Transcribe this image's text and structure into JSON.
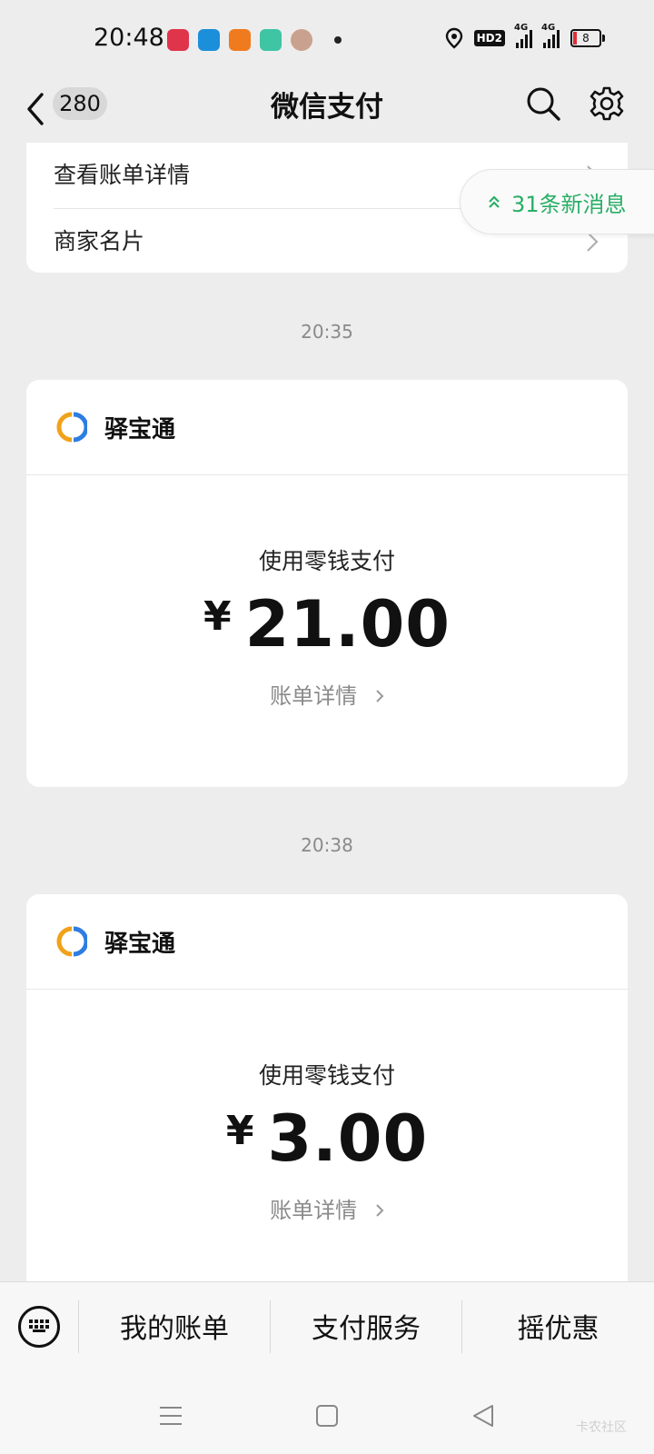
{
  "status_bar": {
    "time": "20:48",
    "hd_label": "HD2",
    "network1": "4G",
    "network2": "4G",
    "battery": "8",
    "app_icon_colors": [
      "#e0344a",
      "#1b8fd9",
      "#f07a1e",
      "#3fc4a4",
      "#caa08e"
    ]
  },
  "nav": {
    "badge_count": "280",
    "title": "微信支付"
  },
  "top_card": {
    "item1": "查看账单详情",
    "item2": "商家名片"
  },
  "new_messages": "31条新消息",
  "messages": [
    {
      "time": "20:35",
      "merchant": "驿宝通",
      "method": "使用零钱支付",
      "currency": "¥",
      "amount": "21.00",
      "detail": "账单详情"
    },
    {
      "time": "20:38",
      "merchant": "驿宝通",
      "method": "使用零钱支付",
      "currency": "¥",
      "amount": "3.00",
      "detail": "账单详情"
    }
  ],
  "bottom_menu": {
    "item1": "我的账单",
    "item2": "支付服务",
    "item3": "摇优惠"
  },
  "watermark": "卡农社区",
  "colors": {
    "accent_green": "#2aae67",
    "logo_orange": "#f0a21a",
    "logo_blue": "#2e7de1"
  }
}
